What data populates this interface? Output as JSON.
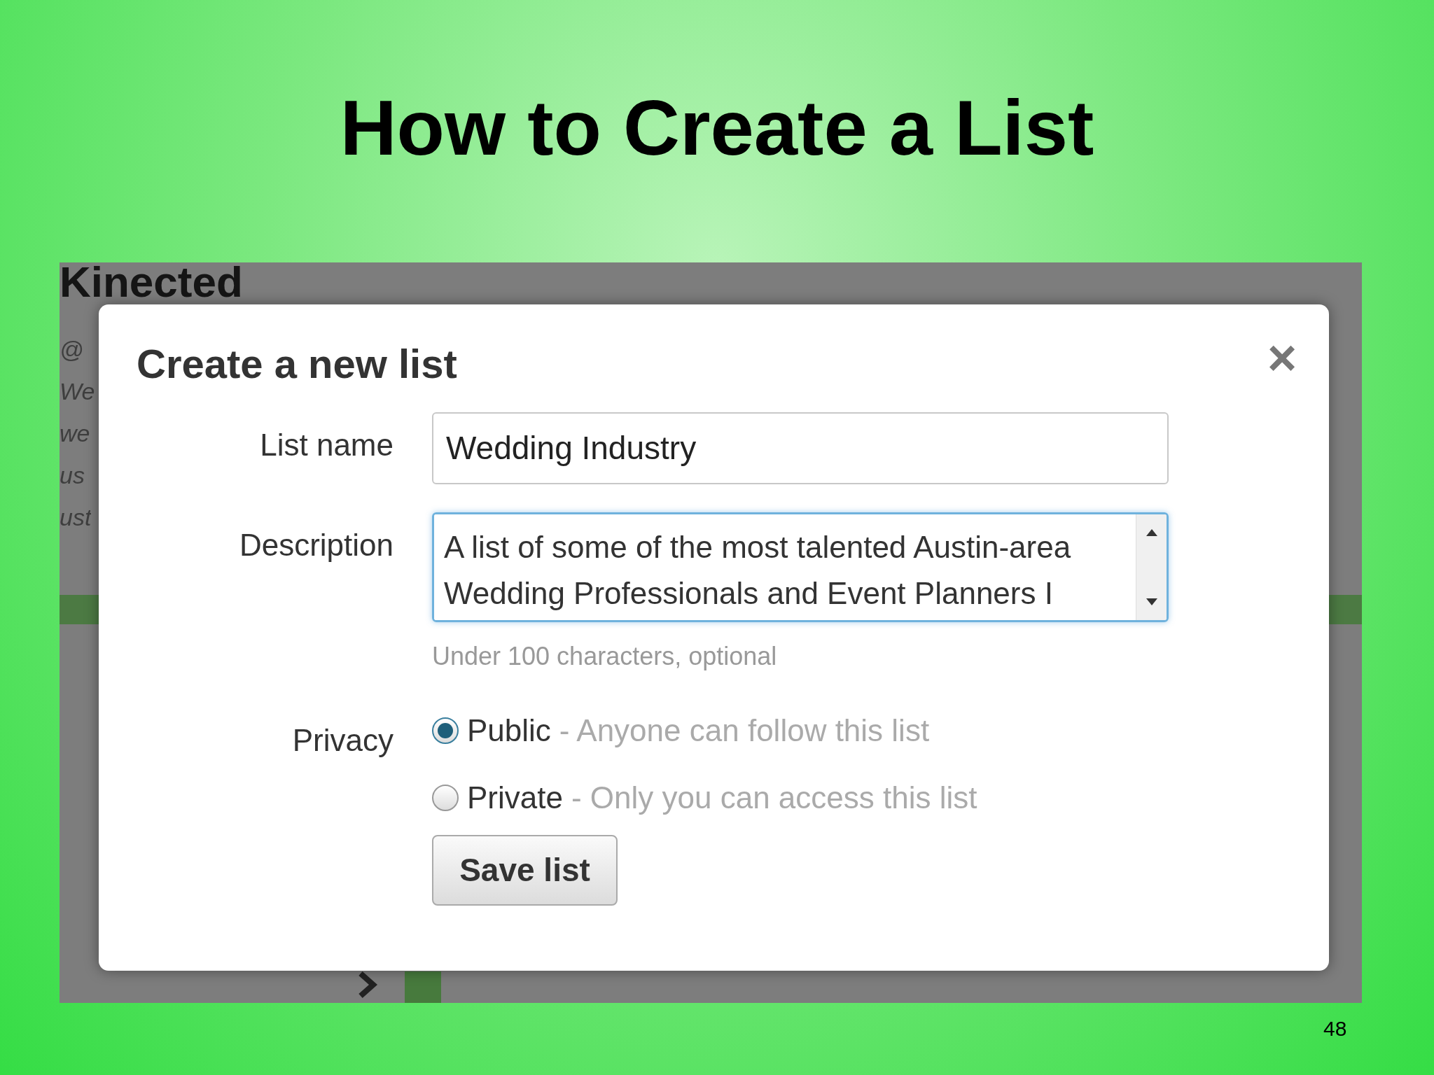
{
  "slide": {
    "title": "How to Create a List",
    "number": "48"
  },
  "background_page": {
    "heading": "Kinected",
    "fragments": [
      "@",
      "We",
      "we",
      "us",
      "ust"
    ]
  },
  "dialog": {
    "title": "Create a new list",
    "close": "×",
    "fields": [
      {
        "kind": "text",
        "label": "List name",
        "value": "Wedding Industry"
      },
      {
        "kind": "textarea",
        "label": "Description",
        "value": "A list of some of the most talented Austin-area Wedding Professionals and Event Planners I",
        "help": "Under 100 characters, optional"
      }
    ],
    "privacy": {
      "label": "Privacy",
      "options": [
        {
          "label": "Public",
          "description": "- Anyone can follow this list",
          "selected": true
        },
        {
          "label": "Private",
          "description": "- Only you can access this list",
          "selected": false
        }
      ]
    },
    "save_button": "Save list"
  }
}
